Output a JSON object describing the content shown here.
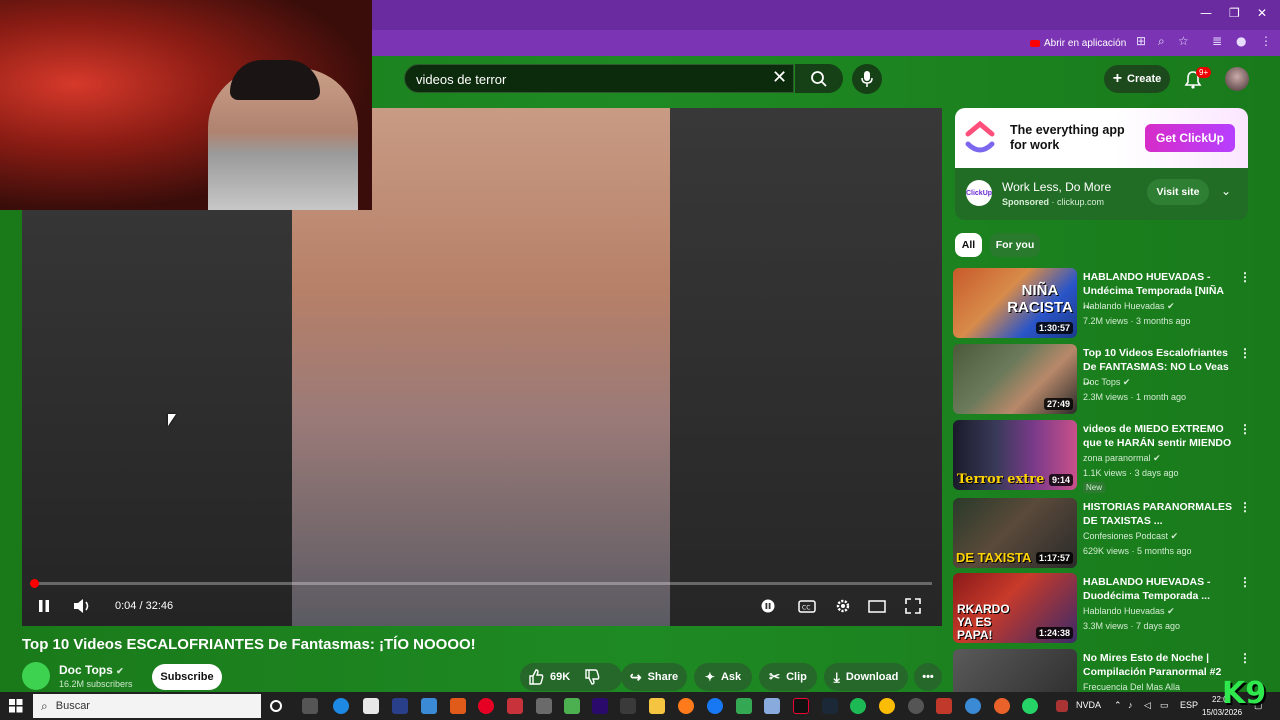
{
  "browser": {
    "open_app_label": "Abrir en aplicación"
  },
  "header": {
    "search_value": "videos de terror",
    "create_label": "Create",
    "notif_count": "9+"
  },
  "player": {
    "time": "0:04 / 32:46",
    "progress": 0.002
  },
  "video": {
    "title": "Top 10 Videos ESCALOFRIANTES De Fantasmas: ¡TÍO NOOOO!",
    "channel": "Doc Tops",
    "subscribers": "16.2M subscribers",
    "subscribe_label": "Subscribe",
    "likes": "69K",
    "share_label": "Share",
    "ask_label": "Ask",
    "clip_label": "Clip",
    "download_label": "Download"
  },
  "ad": {
    "headline": "The everything app for work",
    "cta": "Get ClickUp",
    "avatar_text": "ClickUp",
    "name": "Work Less, Do More",
    "sponsored": "Sponsored",
    "domain": "clickup.com",
    "visit_label": "Visit site"
  },
  "chips": [
    "All",
    "For you"
  ],
  "recommendations": [
    {
      "title": "HABLANDO HUEVADAS - Undécima Temporada [NIÑA ...",
      "channel": "Hablando Huevadas",
      "views": "7.2M views",
      "age": "3 months ago",
      "duration": "1:30:57",
      "thumb_text": "NIÑA RACISTA",
      "badge": ""
    },
    {
      "title": "Top 10 Videos Escalofriantes De FANTASMAS: NO Lo Veas ...",
      "channel": "Doc Tops",
      "views": "2.3M views",
      "age": "1 month ago",
      "duration": "27:49",
      "thumb_text": "",
      "badge": ""
    },
    {
      "title": "videos de MIEDO EXTREMO que te HARÁN sentir MIENDO",
      "channel": "zona paranormal",
      "views": "1.1K views",
      "age": "3 days ago",
      "duration": "9:14",
      "thumb_text": "Terror extre",
      "badge": "New"
    },
    {
      "title": "HISTORIAS PARANORMALES DE TAXISTAS ...",
      "channel": "Confesiones Podcast",
      "views": "629K views",
      "age": "5 months ago",
      "duration": "1:17:57",
      "thumb_text": "DE TAXISTA",
      "badge": ""
    },
    {
      "title": "HABLANDO HUEVADAS - Duodécima Temporada ...",
      "channel": "Hablando Huevadas",
      "views": "3.3M views",
      "age": "7 days ago",
      "duration": "1:24:38",
      "thumb_text": "RKARDO YA ES PAPA!",
      "badge": ""
    },
    {
      "title": "No Mires Esto de Noche | Compilación Paranormal #2",
      "channel": "Frecuencia Del Mas Alla",
      "views": "",
      "age": "",
      "duration": "",
      "thumb_text": "",
      "badge": ""
    }
  ],
  "taskbar": {
    "search_placeholder": "Buscar",
    "tray_app": "NVDA",
    "lang": "ESP",
    "time": "22:0",
    "date": "15/03/2026"
  },
  "overlay_logo": "K9",
  "colors": {
    "page_bg": "#1e8a23",
    "title_bar": "#6a2aa0",
    "accent_red": "#ff0000",
    "cta_gradient_start": "#d62cc8"
  }
}
